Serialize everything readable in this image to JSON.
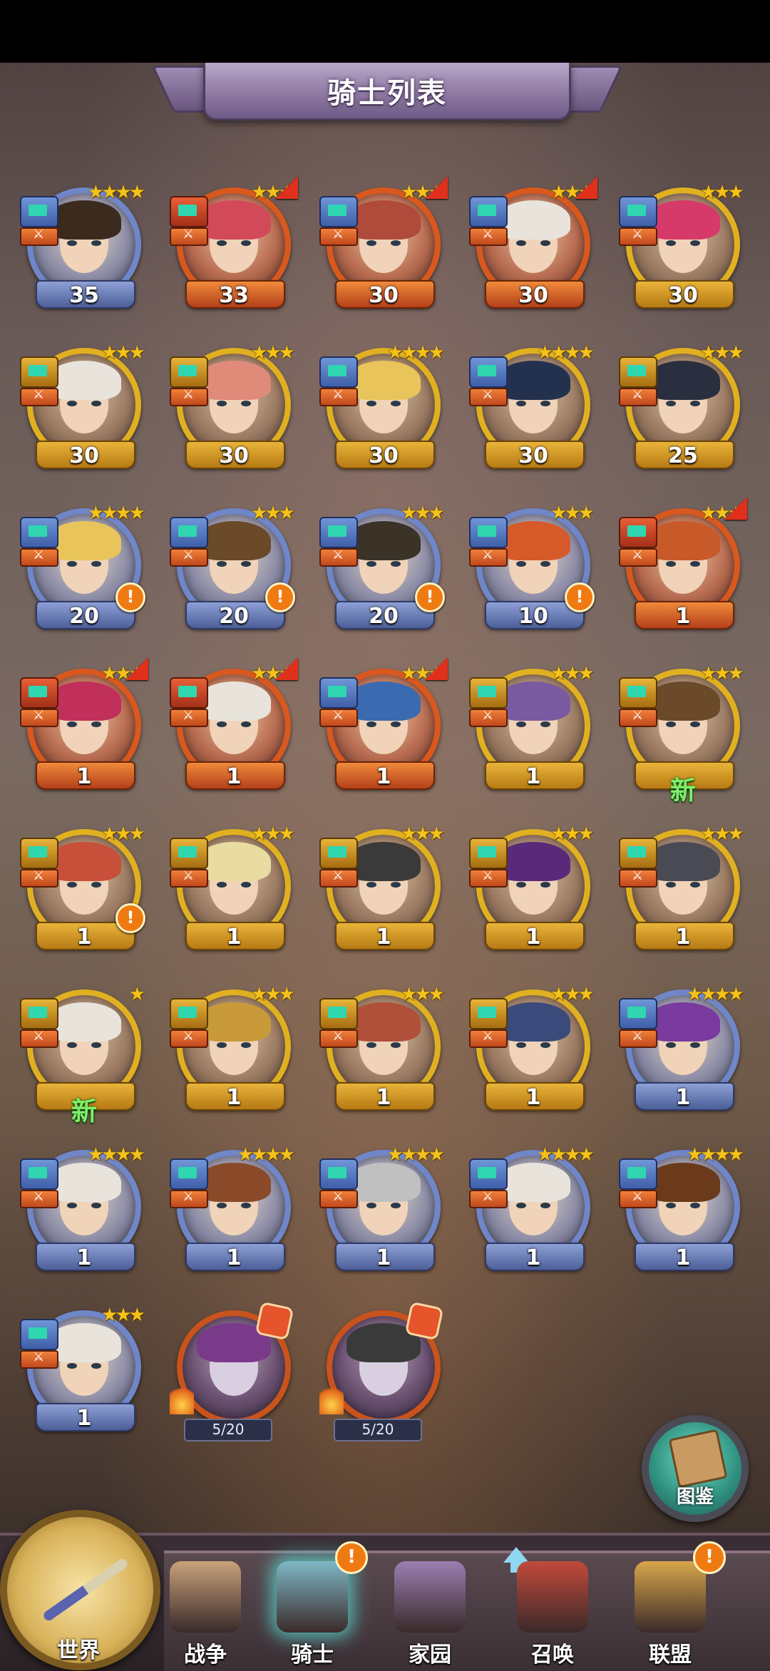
{
  "header": {
    "title": "骑士列表"
  },
  "knights": [
    {
      "level": "35",
      "stars": 4,
      "frame": "blue",
      "rank": "blue",
      "alert": false,
      "new": false,
      "arrow": false,
      "hair": "#3b2a1e"
    },
    {
      "level": "33",
      "stars": 3,
      "frame": "red",
      "rank": "red",
      "alert": false,
      "new": false,
      "arrow": true,
      "hair": "#d24a5a"
    },
    {
      "level": "30",
      "stars": 3,
      "frame": "red",
      "rank": "blue",
      "alert": false,
      "new": false,
      "arrow": true,
      "hair": "#b04a3a"
    },
    {
      "level": "30",
      "stars": 3,
      "frame": "red",
      "rank": "blue",
      "alert": false,
      "new": false,
      "arrow": true,
      "hair": "#e8e4dc"
    },
    {
      "level": "30",
      "stars": 3,
      "frame": "gold",
      "rank": "blue",
      "alert": false,
      "new": false,
      "arrow": false,
      "hair": "#d63a6a"
    },
    {
      "level": "30",
      "stars": 3,
      "frame": "gold",
      "rank": "gold",
      "alert": false,
      "new": false,
      "arrow": false,
      "hair": "#e8e4dc"
    },
    {
      "level": "30",
      "stars": 3,
      "frame": "gold",
      "rank": "gold",
      "alert": false,
      "new": false,
      "arrow": false,
      "hair": "#e08a7a"
    },
    {
      "level": "30",
      "stars": 4,
      "frame": "gold",
      "rank": "blue",
      "alert": false,
      "new": false,
      "arrow": false,
      "hair": "#e8c45a"
    },
    {
      "level": "30",
      "stars": 4,
      "frame": "gold",
      "rank": "blue",
      "alert": false,
      "new": false,
      "arrow": false,
      "hair": "#23314f"
    },
    {
      "level": "25",
      "stars": 3,
      "frame": "gold",
      "rank": "gold",
      "alert": false,
      "new": false,
      "arrow": false,
      "hair": "#2a2f3f"
    },
    {
      "level": "20",
      "stars": 4,
      "frame": "blue",
      "rank": "blue",
      "alert": true,
      "new": false,
      "arrow": false,
      "hair": "#e8c45a"
    },
    {
      "level": "20",
      "stars": 3,
      "frame": "blue",
      "rank": "blue",
      "alert": true,
      "new": false,
      "arrow": false,
      "hair": "#6b4a2a"
    },
    {
      "level": "20",
      "stars": 3,
      "frame": "blue",
      "rank": "blue",
      "alert": true,
      "new": false,
      "arrow": false,
      "hair": "#3b3328"
    },
    {
      "level": "10",
      "stars": 3,
      "frame": "blue",
      "rank": "blue",
      "alert": true,
      "new": false,
      "arrow": false,
      "hair": "#d65a2a"
    },
    {
      "level": "1",
      "stars": 3,
      "frame": "red",
      "rank": "red",
      "alert": false,
      "new": false,
      "arrow": true,
      "hair": "#c85a2a"
    },
    {
      "level": "1",
      "stars": 3,
      "frame": "red",
      "rank": "red",
      "alert": false,
      "new": false,
      "arrow": true,
      "hair": "#c0305a"
    },
    {
      "level": "1",
      "stars": 3,
      "frame": "red",
      "rank": "red",
      "alert": false,
      "new": false,
      "arrow": true,
      "hair": "#e8e4dc"
    },
    {
      "level": "1",
      "stars": 3,
      "frame": "red",
      "rank": "blue",
      "alert": false,
      "new": false,
      "arrow": true,
      "hair": "#3a6ab0"
    },
    {
      "level": "1",
      "stars": 3,
      "frame": "gold",
      "rank": "gold",
      "alert": false,
      "new": false,
      "arrow": false,
      "hair": "#7a5aa0"
    },
    {
      "level": "",
      "stars": 3,
      "frame": "gold",
      "rank": "gold",
      "alert": false,
      "new": true,
      "arrow": false,
      "hair": "#6b4a2a"
    },
    {
      "level": "1",
      "stars": 3,
      "frame": "gold",
      "rank": "gold",
      "alert": true,
      "new": false,
      "arrow": false,
      "hair": "#c8503a"
    },
    {
      "level": "1",
      "stars": 3,
      "frame": "gold",
      "rank": "gold",
      "alert": false,
      "new": false,
      "arrow": false,
      "hair": "#e8dca0"
    },
    {
      "level": "1",
      "stars": 3,
      "frame": "gold",
      "rank": "gold",
      "alert": false,
      "new": false,
      "arrow": false,
      "hair": "#3a3a3a"
    },
    {
      "level": "1",
      "stars": 3,
      "frame": "gold",
      "rank": "gold",
      "alert": false,
      "new": false,
      "arrow": false,
      "hair": "#5a2a7a"
    },
    {
      "level": "1",
      "stars": 3,
      "frame": "gold",
      "rank": "gold",
      "alert": false,
      "new": false,
      "arrow": false,
      "hair": "#4a4a55"
    },
    {
      "level": "",
      "stars": 1,
      "frame": "gold",
      "rank": "gold",
      "alert": false,
      "new": true,
      "arrow": false,
      "hair": "#e8e4dc"
    },
    {
      "level": "1",
      "stars": 3,
      "frame": "gold",
      "rank": "gold",
      "alert": false,
      "new": false,
      "arrow": false,
      "hair": "#c89a3a"
    },
    {
      "level": "1",
      "stars": 3,
      "frame": "gold",
      "rank": "gold",
      "alert": false,
      "new": false,
      "arrow": false,
      "hair": "#b0503a"
    },
    {
      "level": "1",
      "stars": 3,
      "frame": "gold",
      "rank": "gold",
      "alert": false,
      "new": false,
      "arrow": false,
      "hair": "#3a4a7a"
    },
    {
      "level": "1",
      "stars": 4,
      "frame": "blue",
      "rank": "blue",
      "alert": false,
      "new": false,
      "arrow": false,
      "hair": "#7a3aa0"
    },
    {
      "level": "1",
      "stars": 4,
      "frame": "blue",
      "rank": "blue",
      "alert": false,
      "new": false,
      "arrow": false,
      "hair": "#e8e4dc"
    },
    {
      "level": "1",
      "stars": 4,
      "frame": "blue",
      "rank": "blue",
      "alert": false,
      "new": false,
      "arrow": false,
      "hair": "#8a4a2a"
    },
    {
      "level": "1",
      "stars": 4,
      "frame": "blue",
      "rank": "blue",
      "alert": false,
      "new": false,
      "arrow": false,
      "hair": "#c0c0c0"
    },
    {
      "level": "1",
      "stars": 4,
      "frame": "blue",
      "rank": "blue",
      "alert": false,
      "new": false,
      "arrow": false,
      "hair": "#e8e4dc"
    },
    {
      "level": "1",
      "stars": 4,
      "frame": "blue",
      "rank": "blue",
      "alert": false,
      "new": false,
      "arrow": false,
      "hair": "#6a3a1a"
    },
    {
      "level": "1",
      "stars": 3,
      "frame": "blue",
      "rank": "blue",
      "alert": false,
      "new": false,
      "arrow": false,
      "hair": "#e8e4dc"
    }
  ],
  "shards": [
    {
      "progress": "5/20",
      "hair": "#7a3a8a"
    },
    {
      "progress": "5/20",
      "hair": "#3a3a3a"
    }
  ],
  "codex": {
    "label": "图鉴"
  },
  "nav": {
    "world": "世界",
    "items": [
      {
        "label": "战争",
        "icon": "map-icon",
        "color": "#c9a27a",
        "alert": false
      },
      {
        "label": "骑士",
        "icon": "knight-icon",
        "color": "#7fb8c6",
        "alert": true
      },
      {
        "label": "家园",
        "icon": "house-icon",
        "color": "#9b7fb2",
        "alert": false
      },
      {
        "label": "召唤",
        "icon": "train-icon",
        "color": "#c24a3a",
        "alert": false
      },
      {
        "label": "联盟",
        "icon": "chest-icon",
        "color": "#d8a64a",
        "alert": true
      }
    ]
  }
}
